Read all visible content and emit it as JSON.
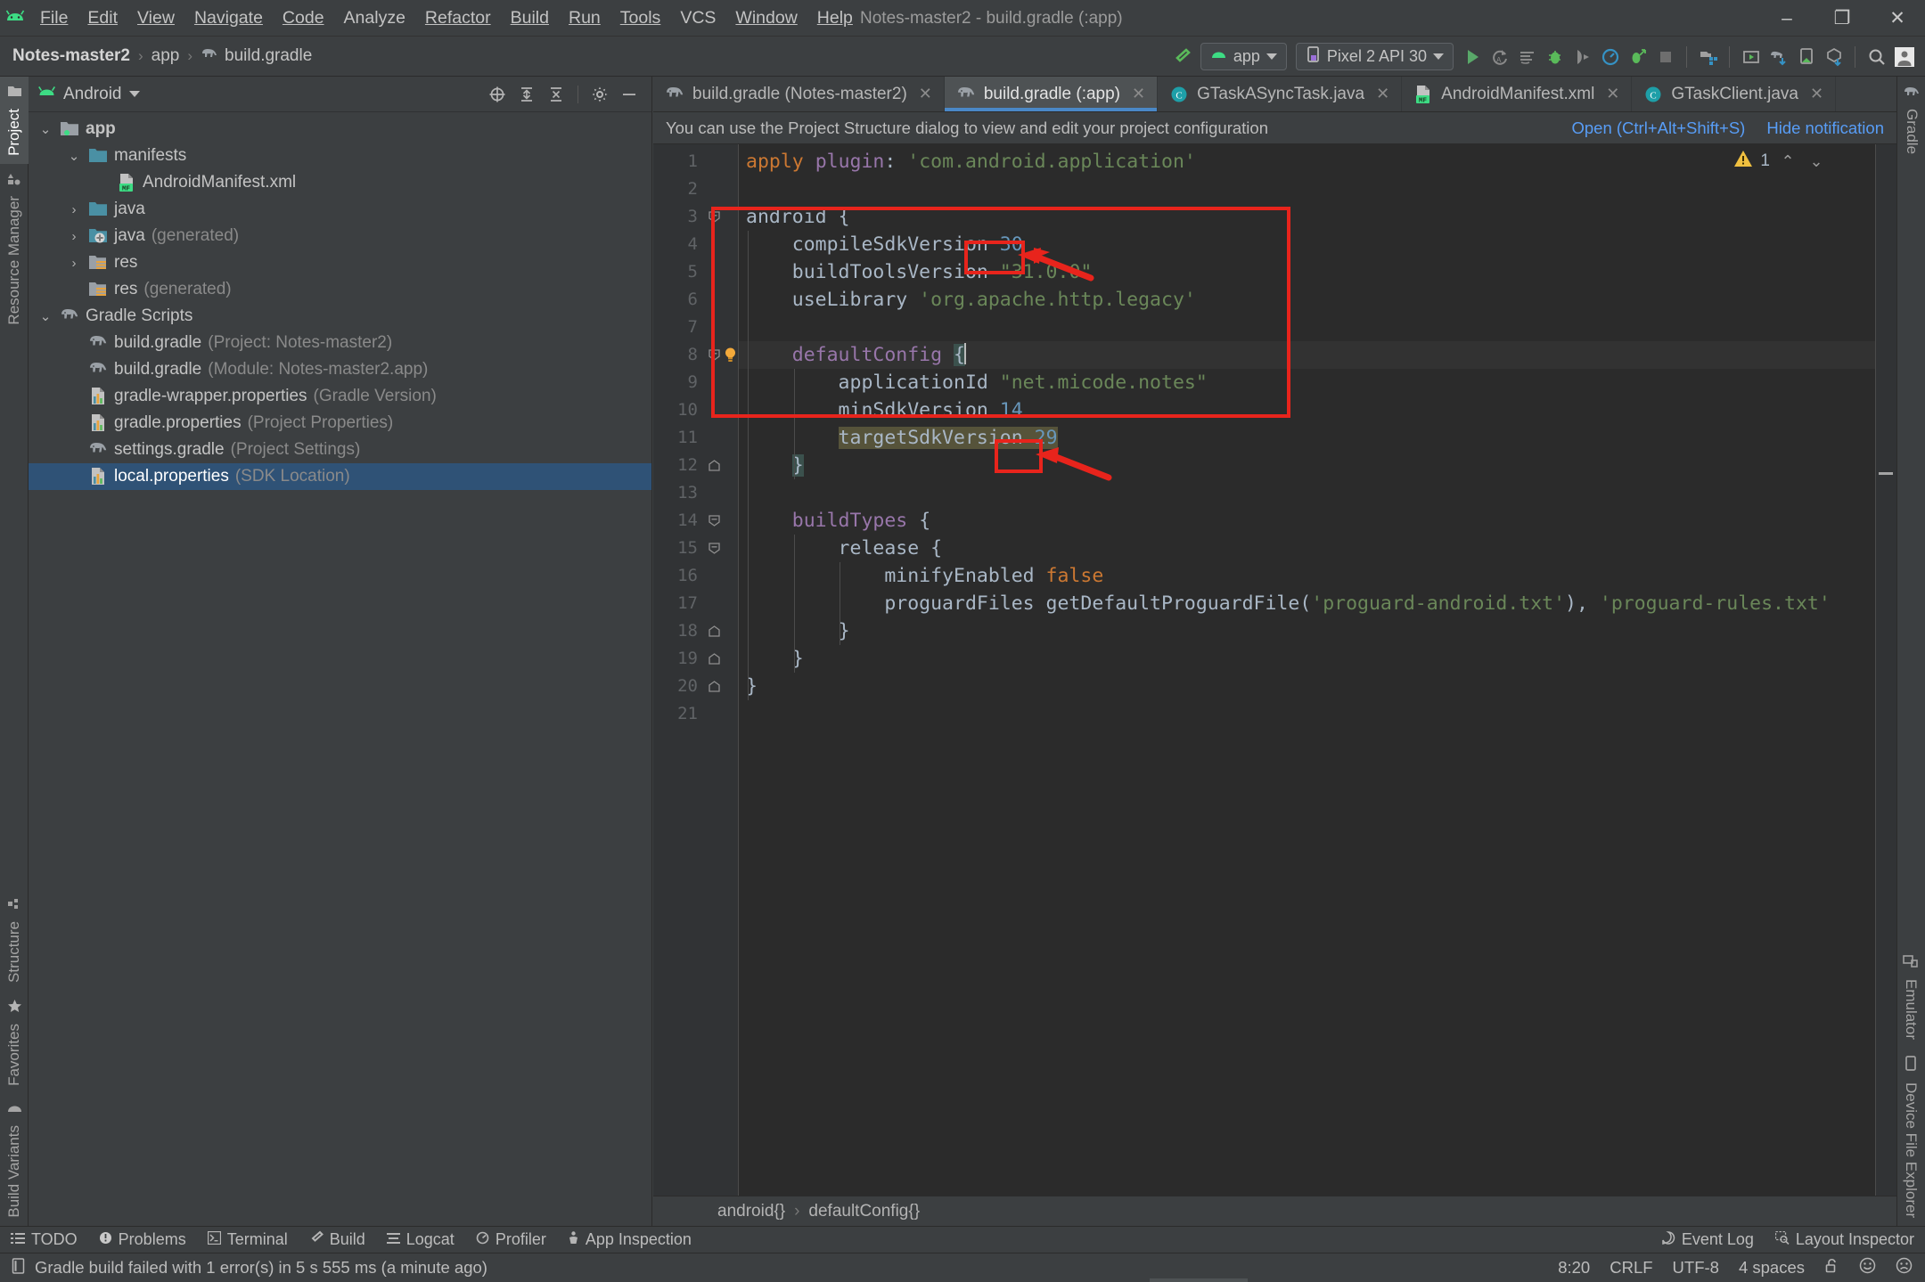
{
  "window": {
    "title": "Notes-master2 - build.gradle (:app)",
    "minimize": "–",
    "maximize": "❐",
    "close": "✕"
  },
  "menubar": {
    "items": [
      "File",
      "Edit",
      "View",
      "Navigate",
      "Code",
      "Analyze",
      "Refactor",
      "Build",
      "Run",
      "Tools",
      "VCS",
      "Window",
      "Help"
    ]
  },
  "navbar": {
    "crumbs": [
      "Notes-master2",
      "app",
      "build.gradle"
    ],
    "separator": "›",
    "run_config": "app",
    "device": "Pixel 2 API 30"
  },
  "left_strip": {
    "top": [
      {
        "label": "Project",
        "icon": "folder-icon",
        "active": true
      },
      {
        "label": "Resource Manager",
        "icon": "resource-manager-icon",
        "active": false
      }
    ],
    "bottom": [
      {
        "label": "Build Variants",
        "icon": "android-icon"
      },
      {
        "label": "Favorites",
        "icon": "star-icon"
      },
      {
        "label": "Structure",
        "icon": "structure-icon"
      }
    ]
  },
  "right_strip": {
    "top": [
      {
        "label": "Gradle",
        "icon": "gradle-elephant-icon"
      }
    ],
    "bottom": [
      {
        "label": "Device File Explorer",
        "icon": "device-icon"
      },
      {
        "label": "Emulator",
        "icon": "emulator-icon"
      }
    ]
  },
  "project_panel": {
    "title": "Android",
    "tree": [
      {
        "indent": 0,
        "arrow": "down",
        "icon": "module-folder-icon",
        "label": "app",
        "meta": "",
        "bold": true,
        "selected": false
      },
      {
        "indent": 1,
        "arrow": "down",
        "icon": "folder-icon",
        "label": "manifests",
        "meta": "",
        "bold": false,
        "selected": false
      },
      {
        "indent": 2,
        "arrow": "none",
        "icon": "manifest-file-icon",
        "label": "AndroidManifest.xml",
        "meta": "",
        "bold": false,
        "selected": false
      },
      {
        "indent": 1,
        "arrow": "right",
        "icon": "folder-icon",
        "label": "java",
        "meta": "",
        "bold": false,
        "selected": false
      },
      {
        "indent": 1,
        "arrow": "right",
        "icon": "generated-folder-icon",
        "label": "java",
        "meta": "(generated)",
        "bold": false,
        "selected": false
      },
      {
        "indent": 1,
        "arrow": "right",
        "icon": "res-folder-icon",
        "label": "res",
        "meta": "",
        "bold": false,
        "selected": false
      },
      {
        "indent": 1,
        "arrow": "none",
        "icon": "res-folder-icon",
        "label": "res",
        "meta": "(generated)",
        "bold": false,
        "selected": false
      },
      {
        "indent": 0,
        "arrow": "down",
        "icon": "gradle-elephant-icon",
        "label": "Gradle Scripts",
        "meta": "",
        "bold": false,
        "selected": false
      },
      {
        "indent": 1,
        "arrow": "none",
        "icon": "gradle-elephant-icon",
        "label": "build.gradle",
        "meta": "(Project: Notes-master2)",
        "bold": false,
        "selected": false
      },
      {
        "indent": 1,
        "arrow": "none",
        "icon": "gradle-elephant-icon",
        "label": "build.gradle",
        "meta": "(Module: Notes-master2.app)",
        "bold": false,
        "selected": false
      },
      {
        "indent": 1,
        "arrow": "none",
        "icon": "properties-file-icon",
        "label": "gradle-wrapper.properties",
        "meta": "(Gradle Version)",
        "bold": false,
        "selected": false
      },
      {
        "indent": 1,
        "arrow": "none",
        "icon": "properties-file-icon",
        "label": "gradle.properties",
        "meta": "(Project Properties)",
        "bold": false,
        "selected": false
      },
      {
        "indent": 1,
        "arrow": "none",
        "icon": "gradle-elephant-icon",
        "label": "settings.gradle",
        "meta": "(Project Settings)",
        "bold": false,
        "selected": false
      },
      {
        "indent": 1,
        "arrow": "none",
        "icon": "properties-file-icon",
        "label": "local.properties",
        "meta": "(SDK Location)",
        "bold": false,
        "selected": true
      }
    ]
  },
  "editor": {
    "tabs": [
      {
        "label": "build.gradle (Notes-master2)",
        "icon": "gradle-elephant-icon",
        "active": false
      },
      {
        "label": "build.gradle (:app)",
        "icon": "gradle-elephant-icon",
        "active": true
      },
      {
        "label": "GTaskASyncTask.java",
        "icon": "java-class-icon",
        "active": false
      },
      {
        "label": "AndroidManifest.xml",
        "icon": "manifest-file-icon",
        "active": false
      },
      {
        "label": "GTaskClient.java",
        "icon": "java-class-icon",
        "active": false
      }
    ],
    "close_glyph": "✕",
    "notification": {
      "message": "You can use the Project Structure dialog to view and edit your project configuration",
      "open_label": "Open (Ctrl+Alt+Shift+S)",
      "hide_label": "Hide notification"
    },
    "warning_count": "1",
    "warning_up": "⌃",
    "warning_down": "⌄",
    "breadcrumb": [
      "android{}",
      "defaultConfig{}"
    ],
    "breadcrumb_sep": "›",
    "line_count": 21,
    "lines": [
      {
        "n": 1,
        "text": "apply plugin: 'com.android.application'"
      },
      {
        "n": 2,
        "text": ""
      },
      {
        "n": 3,
        "text": "android {"
      },
      {
        "n": 4,
        "text": "    compileSdkVersion 30"
      },
      {
        "n": 5,
        "text": "    buildToolsVersion \"31.0.0\""
      },
      {
        "n": 6,
        "text": "    useLibrary 'org.apache.http.legacy'"
      },
      {
        "n": 7,
        "text": ""
      },
      {
        "n": 8,
        "text": "    defaultConfig {"
      },
      {
        "n": 9,
        "text": "        applicationId \"net.micode.notes\""
      },
      {
        "n": 10,
        "text": "        minSdkVersion 14"
      },
      {
        "n": 11,
        "text": "        targetSdkVersion 29"
      },
      {
        "n": 12,
        "text": "    }"
      },
      {
        "n": 13,
        "text": ""
      },
      {
        "n": 14,
        "text": "    buildTypes {"
      },
      {
        "n": 15,
        "text": "        release {"
      },
      {
        "n": 16,
        "text": "            minifyEnabled false"
      },
      {
        "n": 17,
        "text": "            proguardFiles getDefaultProguardFile('proguard-android.txt'), 'proguard-rules.txt'"
      },
      {
        "n": 18,
        "text": "        }"
      },
      {
        "n": 19,
        "text": "    }"
      },
      {
        "n": 20,
        "text": "}"
      },
      {
        "n": 21,
        "text": ""
      }
    ],
    "annotations": {
      "outer_box_label": "android-block-highlight",
      "compile_sdk_value": "30",
      "target_sdk_value": "29",
      "color": "#e8241c"
    }
  },
  "toolwindow_bar": {
    "left": [
      {
        "label": "TODO",
        "icon": "todo-icon"
      },
      {
        "label": "Problems",
        "icon": "problems-icon"
      },
      {
        "label": "Terminal",
        "icon": "terminal-icon"
      },
      {
        "label": "Build",
        "icon": "build-hammer-icon"
      },
      {
        "label": "Logcat",
        "icon": "logcat-icon"
      },
      {
        "label": "Profiler",
        "icon": "profiler-icon"
      },
      {
        "label": "App Inspection",
        "icon": "app-inspection-icon"
      }
    ],
    "right": [
      {
        "label": "Event Log",
        "icon": "event-log-icon"
      },
      {
        "label": "Layout Inspector",
        "icon": "layout-inspector-icon"
      }
    ]
  },
  "status_bar": {
    "message": "Gradle build failed with 1 error(s) in 5 s 555 ms (a minute ago)",
    "caret_position": "8:20",
    "line_separator": "CRLF",
    "encoding": "UTF-8",
    "indent": "4 spaces",
    "lock_icon": "unlocked-icon",
    "happy_icon": "happy-face-icon",
    "sad_icon": "sad-face-icon"
  }
}
